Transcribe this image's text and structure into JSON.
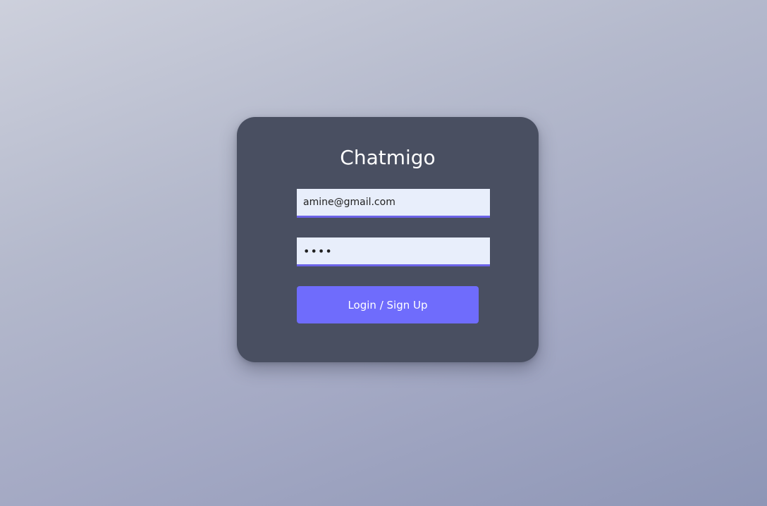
{
  "app": {
    "title": "Chatmigo"
  },
  "login_form": {
    "email_value": "amine@gmail.com",
    "password_value": "••••",
    "submit_label": "Login / Sign Up"
  },
  "colors": {
    "card_background": "#494f61",
    "input_background": "#e8eefb",
    "input_underline": "#6c63e8",
    "button_background": "#6f6cfc",
    "title_text": "#ffffff"
  }
}
